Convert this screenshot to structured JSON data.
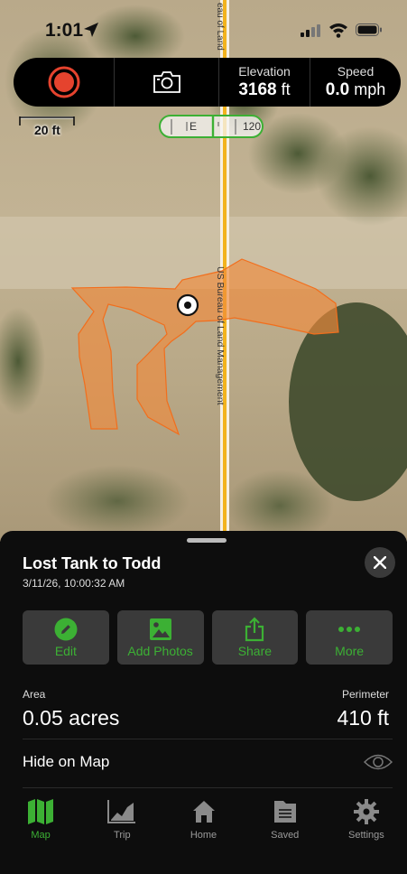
{
  "status_bar": {
    "time": "1:01"
  },
  "toolbar": {
    "elevation": {
      "label": "Elevation",
      "value": "3168",
      "unit": "ft"
    },
    "speed": {
      "label": "Speed",
      "value": "0.0",
      "unit": "mph"
    }
  },
  "map": {
    "scale_label": "20 ft",
    "compass": {
      "direction": "E",
      "degrees": "120"
    },
    "road_label_top": "eau of Land",
    "road_label_main": "US Bureau of Land Management",
    "colors": {
      "shape_fill": "#f08a3c",
      "road": "#f2b31e",
      "accent": "#3cb034"
    }
  },
  "sheet": {
    "title": "Lost Tank to Todd",
    "subtitle": "3/11/26, 10:00:32 AM",
    "actions": [
      {
        "label": "Edit",
        "icon": "pencil-icon"
      },
      {
        "label": "Add Photos",
        "icon": "photo-icon"
      },
      {
        "label": "Share",
        "icon": "share-icon"
      },
      {
        "label": "More",
        "icon": "ellipsis-icon"
      }
    ],
    "area": {
      "label": "Area",
      "value": "0.05 acres"
    },
    "perimeter": {
      "label": "Perimeter",
      "value": "410 ft"
    },
    "hide_on_map": "Hide on Map"
  },
  "tabs": [
    {
      "label": "Map",
      "icon": "map-icon",
      "active": true
    },
    {
      "label": "Trip",
      "icon": "chart-icon",
      "active": false
    },
    {
      "label": "Home",
      "icon": "home-icon",
      "active": false
    },
    {
      "label": "Saved",
      "icon": "folder-icon",
      "active": false
    },
    {
      "label": "Settings",
      "icon": "gear-icon",
      "active": false
    }
  ]
}
